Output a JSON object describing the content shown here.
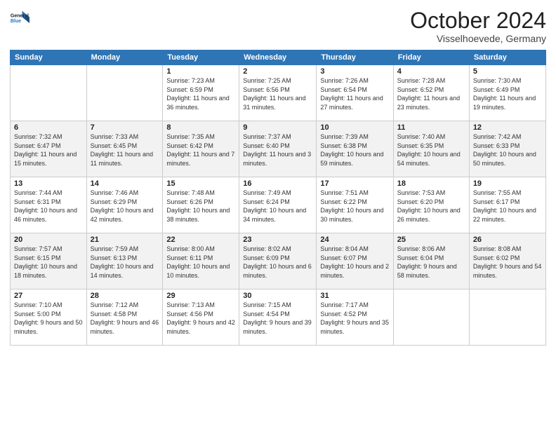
{
  "logo": {
    "line1": "General",
    "line2": "Blue"
  },
  "title": "October 2024",
  "location": "Visselhoevede, Germany",
  "days_header": [
    "Sunday",
    "Monday",
    "Tuesday",
    "Wednesday",
    "Thursday",
    "Friday",
    "Saturday"
  ],
  "weeks": [
    [
      {
        "day": "",
        "sunrise": "",
        "sunset": "",
        "daylight": ""
      },
      {
        "day": "",
        "sunrise": "",
        "sunset": "",
        "daylight": ""
      },
      {
        "day": "1",
        "sunrise": "Sunrise: 7:23 AM",
        "sunset": "Sunset: 6:59 PM",
        "daylight": "Daylight: 11 hours and 36 minutes."
      },
      {
        "day": "2",
        "sunrise": "Sunrise: 7:25 AM",
        "sunset": "Sunset: 6:56 PM",
        "daylight": "Daylight: 11 hours and 31 minutes."
      },
      {
        "day": "3",
        "sunrise": "Sunrise: 7:26 AM",
        "sunset": "Sunset: 6:54 PM",
        "daylight": "Daylight: 11 hours and 27 minutes."
      },
      {
        "day": "4",
        "sunrise": "Sunrise: 7:28 AM",
        "sunset": "Sunset: 6:52 PM",
        "daylight": "Daylight: 11 hours and 23 minutes."
      },
      {
        "day": "5",
        "sunrise": "Sunrise: 7:30 AM",
        "sunset": "Sunset: 6:49 PM",
        "daylight": "Daylight: 11 hours and 19 minutes."
      }
    ],
    [
      {
        "day": "6",
        "sunrise": "Sunrise: 7:32 AM",
        "sunset": "Sunset: 6:47 PM",
        "daylight": "Daylight: 11 hours and 15 minutes."
      },
      {
        "day": "7",
        "sunrise": "Sunrise: 7:33 AM",
        "sunset": "Sunset: 6:45 PM",
        "daylight": "Daylight: 11 hours and 11 minutes."
      },
      {
        "day": "8",
        "sunrise": "Sunrise: 7:35 AM",
        "sunset": "Sunset: 6:42 PM",
        "daylight": "Daylight: 11 hours and 7 minutes."
      },
      {
        "day": "9",
        "sunrise": "Sunrise: 7:37 AM",
        "sunset": "Sunset: 6:40 PM",
        "daylight": "Daylight: 11 hours and 3 minutes."
      },
      {
        "day": "10",
        "sunrise": "Sunrise: 7:39 AM",
        "sunset": "Sunset: 6:38 PM",
        "daylight": "Daylight: 10 hours and 59 minutes."
      },
      {
        "day": "11",
        "sunrise": "Sunrise: 7:40 AM",
        "sunset": "Sunset: 6:35 PM",
        "daylight": "Daylight: 10 hours and 54 minutes."
      },
      {
        "day": "12",
        "sunrise": "Sunrise: 7:42 AM",
        "sunset": "Sunset: 6:33 PM",
        "daylight": "Daylight: 10 hours and 50 minutes."
      }
    ],
    [
      {
        "day": "13",
        "sunrise": "Sunrise: 7:44 AM",
        "sunset": "Sunset: 6:31 PM",
        "daylight": "Daylight: 10 hours and 46 minutes."
      },
      {
        "day": "14",
        "sunrise": "Sunrise: 7:46 AM",
        "sunset": "Sunset: 6:29 PM",
        "daylight": "Daylight: 10 hours and 42 minutes."
      },
      {
        "day": "15",
        "sunrise": "Sunrise: 7:48 AM",
        "sunset": "Sunset: 6:26 PM",
        "daylight": "Daylight: 10 hours and 38 minutes."
      },
      {
        "day": "16",
        "sunrise": "Sunrise: 7:49 AM",
        "sunset": "Sunset: 6:24 PM",
        "daylight": "Daylight: 10 hours and 34 minutes."
      },
      {
        "day": "17",
        "sunrise": "Sunrise: 7:51 AM",
        "sunset": "Sunset: 6:22 PM",
        "daylight": "Daylight: 10 hours and 30 minutes."
      },
      {
        "day": "18",
        "sunrise": "Sunrise: 7:53 AM",
        "sunset": "Sunset: 6:20 PM",
        "daylight": "Daylight: 10 hours and 26 minutes."
      },
      {
        "day": "19",
        "sunrise": "Sunrise: 7:55 AM",
        "sunset": "Sunset: 6:17 PM",
        "daylight": "Daylight: 10 hours and 22 minutes."
      }
    ],
    [
      {
        "day": "20",
        "sunrise": "Sunrise: 7:57 AM",
        "sunset": "Sunset: 6:15 PM",
        "daylight": "Daylight: 10 hours and 18 minutes."
      },
      {
        "day": "21",
        "sunrise": "Sunrise: 7:59 AM",
        "sunset": "Sunset: 6:13 PM",
        "daylight": "Daylight: 10 hours and 14 minutes."
      },
      {
        "day": "22",
        "sunrise": "Sunrise: 8:00 AM",
        "sunset": "Sunset: 6:11 PM",
        "daylight": "Daylight: 10 hours and 10 minutes."
      },
      {
        "day": "23",
        "sunrise": "Sunrise: 8:02 AM",
        "sunset": "Sunset: 6:09 PM",
        "daylight": "Daylight: 10 hours and 6 minutes."
      },
      {
        "day": "24",
        "sunrise": "Sunrise: 8:04 AM",
        "sunset": "Sunset: 6:07 PM",
        "daylight": "Daylight: 10 hours and 2 minutes."
      },
      {
        "day": "25",
        "sunrise": "Sunrise: 8:06 AM",
        "sunset": "Sunset: 6:04 PM",
        "daylight": "Daylight: 9 hours and 58 minutes."
      },
      {
        "day": "26",
        "sunrise": "Sunrise: 8:08 AM",
        "sunset": "Sunset: 6:02 PM",
        "daylight": "Daylight: 9 hours and 54 minutes."
      }
    ],
    [
      {
        "day": "27",
        "sunrise": "Sunrise: 7:10 AM",
        "sunset": "Sunset: 5:00 PM",
        "daylight": "Daylight: 9 hours and 50 minutes."
      },
      {
        "day": "28",
        "sunrise": "Sunrise: 7:12 AM",
        "sunset": "Sunset: 4:58 PM",
        "daylight": "Daylight: 9 hours and 46 minutes."
      },
      {
        "day": "29",
        "sunrise": "Sunrise: 7:13 AM",
        "sunset": "Sunset: 4:56 PM",
        "daylight": "Daylight: 9 hours and 42 minutes."
      },
      {
        "day": "30",
        "sunrise": "Sunrise: 7:15 AM",
        "sunset": "Sunset: 4:54 PM",
        "daylight": "Daylight: 9 hours and 39 minutes."
      },
      {
        "day": "31",
        "sunrise": "Sunrise: 7:17 AM",
        "sunset": "Sunset: 4:52 PM",
        "daylight": "Daylight: 9 hours and 35 minutes."
      },
      {
        "day": "",
        "sunrise": "",
        "sunset": "",
        "daylight": ""
      },
      {
        "day": "",
        "sunrise": "",
        "sunset": "",
        "daylight": ""
      }
    ]
  ]
}
